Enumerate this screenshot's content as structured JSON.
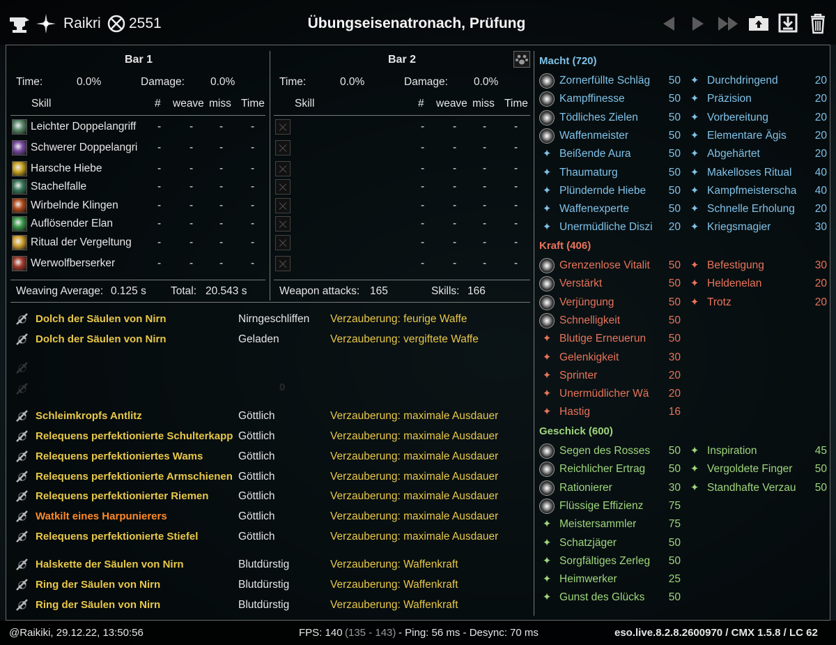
{
  "colors": {
    "macht": "#80c2e8",
    "kraft": "#e8745a",
    "geschick": "#9ed67c",
    "gold": "#e8c84a",
    "orange": "#ff8a2a"
  },
  "header": {
    "player_name": "Raikri",
    "champion_points": "2551",
    "title": "Übungseisenatronach, Prüfung",
    "icons": [
      "anvil-icon",
      "spark-icon",
      "cp-icon",
      "prev-icon",
      "next-icon",
      "skip-icon",
      "upload-icon",
      "save-icon",
      "trash-icon"
    ]
  },
  "bar1": {
    "title": "Bar 1",
    "time_label": "Time:",
    "time_value": "0.0%",
    "damage_label": "Damage:",
    "damage_value": "0.0%",
    "cols": {
      "skill": "Skill",
      "count": "#",
      "weave": "weave",
      "miss": "miss",
      "time": "Time"
    },
    "skills": [
      {
        "name": "Leichter Doppelangriff",
        "v": [
          "-",
          "-",
          "-",
          "-"
        ],
        "icon": "#5a8a6a"
      },
      {
        "name": "Schwerer Doppelangri",
        "v": [
          "-",
          "-",
          "-",
          "-"
        ],
        "icon": "#7a4aa0"
      },
      {
        "name": "Harsche Hiebe",
        "v": [
          "-",
          "-",
          "-",
          "-"
        ],
        "icon": "#c8a020"
      },
      {
        "name": "Stachelfalle",
        "v": [
          "-",
          "-",
          "-",
          "-"
        ],
        "icon": "#3a7a5a"
      },
      {
        "name": "Wirbelnde Klingen",
        "v": [
          "-",
          "-",
          "-",
          "-"
        ],
        "icon": "#b04a1a"
      },
      {
        "name": "Auflösender Elan",
        "v": [
          "-",
          "-",
          "-",
          "-"
        ],
        "icon": "#3a9a4a"
      },
      {
        "name": "Ritual der Vergeltung",
        "v": [
          "-",
          "-",
          "-",
          "-"
        ],
        "icon": "#d0a030"
      },
      {
        "name": "Werwolfberserker",
        "v": [
          "-",
          "-",
          "-",
          "-"
        ],
        "icon": "#a03a2a"
      }
    ],
    "footer": {
      "weave_label": "Weaving Average:",
      "weave_value": "0.125 s",
      "total_label": "Total:",
      "total_value": "20.543 s"
    }
  },
  "bar2": {
    "title": "Bar 2",
    "time_label": "Time:",
    "time_value": "0.0%",
    "damage_label": "Damage:",
    "damage_value": "0.0%",
    "cols": {
      "skill": "Skill",
      "count": "#",
      "weave": "weave",
      "miss": "miss",
      "time": "Time"
    },
    "rows": [
      [
        "-",
        "-",
        "-",
        "-"
      ],
      [
        "-",
        "-",
        "-",
        "-"
      ],
      [
        "-",
        "-",
        "-",
        "-"
      ],
      [
        "-",
        "-",
        "-",
        "-"
      ],
      [
        "-",
        "-",
        "-",
        "-"
      ],
      [
        "-",
        "-",
        "-",
        "-"
      ],
      [
        "-",
        "-",
        "-",
        "-"
      ],
      [
        "-",
        "-",
        "-",
        "-"
      ]
    ],
    "footer": {
      "attacks_label": "Weapon attacks:",
      "attacks_value": "165",
      "skills_label": "Skills:",
      "skills_value": "166"
    }
  },
  "gear": {
    "weapons": [
      {
        "name": "Dolch der Säulen von Nirn",
        "trait": "Nirngeschliffen",
        "enchant": "Verzauberung: feurige Waffe",
        "icon": "dagger-icon"
      },
      {
        "name": "Dolch der Säulen von Nirn",
        "trait": "Geladen",
        "enchant": "Verzauberung: vergiftete Waffe",
        "icon": "dagger-icon"
      }
    ],
    "backbar_value": "0",
    "armor": [
      {
        "name": "Schleimkropfs Antlitz",
        "trait": "Göttlich",
        "enchant": "Verzauberung: maximale Ausdauer",
        "icon": "helmet-icon",
        "orange": false
      },
      {
        "name": "Relequens perfektionierte Schulterkapp",
        "trait": "Göttlich",
        "enchant": "Verzauberung: maximale Ausdauer",
        "icon": "shoulder-icon",
        "orange": false
      },
      {
        "name": "Relequens perfektioniertes Wams",
        "trait": "Göttlich",
        "enchant": "Verzauberung: maximale Ausdauer",
        "icon": "chest-icon",
        "orange": false
      },
      {
        "name": "Relequens perfektionierte Armschienen",
        "trait": "Göttlich",
        "enchant": "Verzauberung: maximale Ausdauer",
        "icon": "gloves-icon",
        "orange": false
      },
      {
        "name": "Relequens perfektionierter Riemen",
        "trait": "Göttlich",
        "enchant": "Verzauberung: maximale Ausdauer",
        "icon": "belt-icon",
        "orange": false
      },
      {
        "name": "Watkilt eines Harpunierers",
        "trait": "Göttlich",
        "enchant": "Verzauberung: maximale Ausdauer",
        "icon": "legs-icon",
        "orange": true
      },
      {
        "name": "Relequens perfektionierte Stiefel",
        "trait": "Göttlich",
        "enchant": "Verzauberung: maximale Ausdauer",
        "icon": "boots-icon",
        "orange": false
      }
    ],
    "jewelry": [
      {
        "name": "Halskette der Säulen von Nirn",
        "trait": "Blutdürstig",
        "enchant": "Verzauberung: Waffenkraft",
        "icon": "necklace-icon"
      },
      {
        "name": "Ring der Säulen von Nirn",
        "trait": "Blutdürstig",
        "enchant": "Verzauberung: Waffenkraft",
        "icon": "ring-icon"
      },
      {
        "name": "Ring der Säulen von Nirn",
        "trait": "Blutdürstig",
        "enchant": "Verzauberung: Waffenkraft",
        "icon": "ring-icon"
      }
    ]
  },
  "cp": {
    "macht": {
      "header": "Macht (720)",
      "left": [
        [
          "Zornerfüllte Schläg",
          "50",
          true
        ],
        [
          "Kampffinesse",
          "50",
          true
        ],
        [
          "Tödliches Zielen",
          "50",
          true
        ],
        [
          "Waffenmeister",
          "50",
          true
        ],
        [
          "Beißende Aura",
          "50",
          false
        ],
        [
          "Thaumaturg",
          "50",
          false
        ],
        [
          "Plündernde Hiebe",
          "50",
          false
        ],
        [
          "Waffenexperte",
          "50",
          false
        ],
        [
          "Unermüdliche Diszi",
          "20",
          false
        ]
      ],
      "right": [
        [
          "Durchdringend",
          "20"
        ],
        [
          "Präzision",
          "20"
        ],
        [
          "Vorbereitung",
          "20"
        ],
        [
          "Elementare Ägis",
          "20"
        ],
        [
          "Abgehärtet",
          "20"
        ],
        [
          "Makelloses Ritual",
          "40"
        ],
        [
          "Kampfmeisterscha",
          "40"
        ],
        [
          "Schnelle Erholung",
          "20"
        ],
        [
          "Kriegsmagier",
          "30"
        ]
      ]
    },
    "kraft": {
      "header": "Kraft (406)",
      "left": [
        [
          "Grenzenlose Vitalit",
          "50",
          true
        ],
        [
          "Verstärkt",
          "50",
          true
        ],
        [
          "Verjüngung",
          "50",
          true
        ],
        [
          "Schnelligkeit",
          "50",
          true
        ],
        [
          "Blutige Erneuerun",
          "50",
          false
        ],
        [
          "Gelenkigkeit",
          "30",
          false
        ],
        [
          "Sprinter",
          "20",
          false
        ],
        [
          "Unermüdlicher Wä",
          "20",
          false
        ],
        [
          "Hastig",
          "16",
          false
        ]
      ],
      "right": [
        [
          "Befestigung",
          "30"
        ],
        [
          "Heldenelan",
          "20"
        ],
        [
          "Trotz",
          "20"
        ]
      ]
    },
    "geschick": {
      "header": "Geschick (600)",
      "left": [
        [
          "Segen des Rosses",
          "50",
          true
        ],
        [
          "Reichlicher Ertrag",
          "50",
          true
        ],
        [
          "Rationierer",
          "30",
          true
        ],
        [
          "Flüssige Effizienz",
          "75",
          true
        ],
        [
          "Meistersammler",
          "75",
          false
        ],
        [
          "Schatzjäger",
          "50",
          false
        ],
        [
          "Sorgfältiges Zerleg",
          "50",
          false
        ],
        [
          "Heimwerker",
          "25",
          false
        ],
        [
          "Gunst des Glücks",
          "50",
          false
        ]
      ],
      "right": [
        [
          "Inspiration",
          "45"
        ],
        [
          "Vergoldete Finger",
          "50"
        ],
        [
          "Standhafte Verzau",
          "50"
        ]
      ]
    }
  },
  "footer": {
    "user_time": "@Raikiki, 29.12.22, 13:50:56",
    "fps_label": "FPS: 140",
    "fps_range": "(135 - 143)",
    "ping": "- Ping: 56 ms - Desync: 70 ms",
    "version": "eso.live.8.2.8.2600970 / CMX 1.5.8 / LC 62"
  }
}
